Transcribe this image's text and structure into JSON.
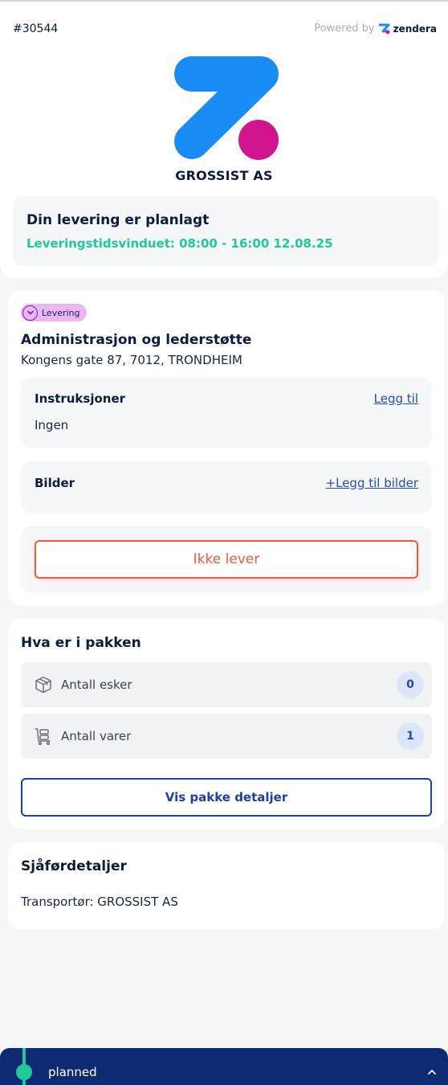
{
  "header": {
    "order_id": "#30544",
    "powered_by": "Powered by",
    "brand": "zendera",
    "company": "GROSSIST AS"
  },
  "status": {
    "title": "Din levering er planlagt",
    "window": "Leveringstidsvinduet: 08:00 - 16:00 12.08.25"
  },
  "delivery": {
    "badge": "Levering",
    "name": "Administrasjon og lederstøtte",
    "address": "Kongens gate 87, 7012, TRONDHEIM",
    "instructions_label": "Instruksjoner",
    "instructions_link": "Legg til",
    "instructions_value": "Ingen",
    "photos_label": "Bilder",
    "photos_link": "+Legg til bilder",
    "no_deliver_button": "Ikke lever"
  },
  "package": {
    "title": "Hva er i pakken",
    "rows": [
      {
        "label": "Antall esker",
        "count": "0",
        "icon": "box-icon"
      },
      {
        "label": "Antall varer",
        "count": "1",
        "icon": "cart-icon"
      }
    ],
    "details_button": "Vis pakke detaljer"
  },
  "driver": {
    "title": "Sjåførdetaljer",
    "carrier": "Transportør: GROSSIST AS"
  },
  "bottom": {
    "status": "planned"
  },
  "colors": {
    "accent_green": "#1fc99a",
    "danger": "#ef5a3f",
    "primary_blue": "#1f3fa8",
    "bar_navy": "#0d2a72",
    "logo_blue": "#1a8cf5",
    "logo_magenta": "#d0158e",
    "badge_purple": "#eab7f5"
  }
}
